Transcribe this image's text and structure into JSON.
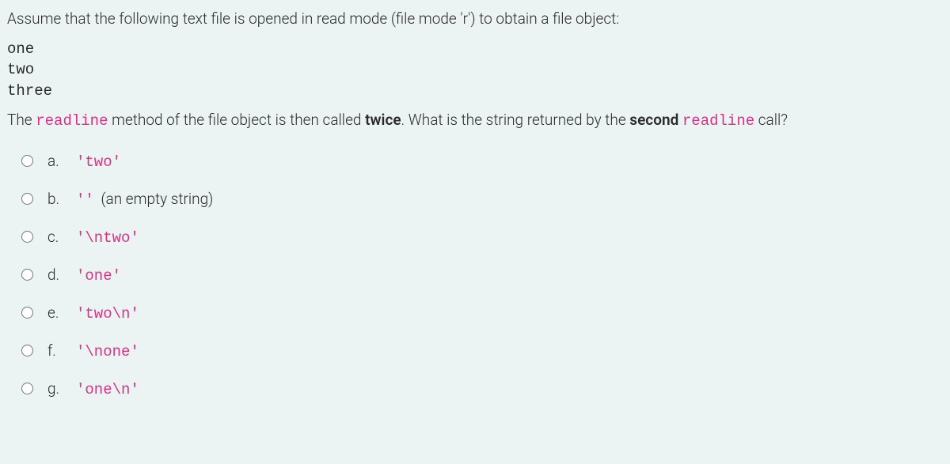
{
  "question": {
    "intro": "Assume that the following text file is opened in read mode (file mode 'r') to obtain a file object:",
    "file_contents": "one\ntwo\nthree",
    "prompt_part1": "The ",
    "prompt_code1": "readline",
    "prompt_part2": " method of the file object is then called ",
    "prompt_bold1": "twice",
    "prompt_part3": ". What is the string returned by the ",
    "prompt_bold2": "second",
    "prompt_part4": " ",
    "prompt_code2": "readline",
    "prompt_part5": " call?"
  },
  "options": [
    {
      "letter": "a.",
      "code": "'two'",
      "extra": ""
    },
    {
      "letter": "b.",
      "code": "''",
      "extra": " (an empty string)"
    },
    {
      "letter": "c.",
      "code": "'\\ntwo'",
      "extra": ""
    },
    {
      "letter": "d.",
      "code": "'one'",
      "extra": ""
    },
    {
      "letter": "e.",
      "code": "'two\\n'",
      "extra": ""
    },
    {
      "letter": "f.",
      "code": "'\\none'",
      "extra": ""
    },
    {
      "letter": "g.",
      "code": "'one\\n'",
      "extra": ""
    }
  ]
}
